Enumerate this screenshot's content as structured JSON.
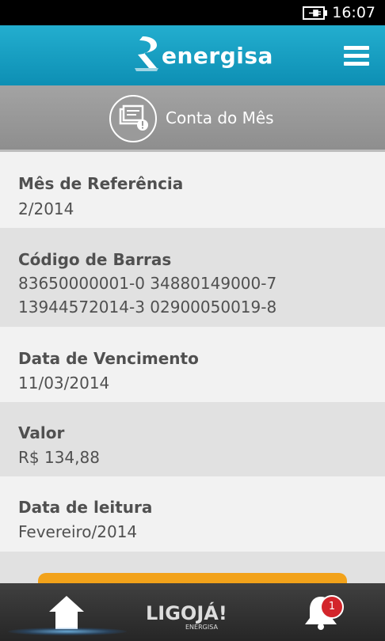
{
  "status_bar": {
    "time": "16:07",
    "battery_icon": "battery-charging-icon"
  },
  "header": {
    "brand": "energisa",
    "logo_icon": "energisa-logo-icon",
    "menu_icon": "hamburger-menu-icon"
  },
  "section": {
    "title": "Conta do Mês",
    "icon": "bill-document-icon"
  },
  "fields": [
    {
      "label": "Mês de Referência",
      "value": "2/2014"
    },
    {
      "label": "Código de Barras",
      "value_line1": "83650000001-0 34880149000-7",
      "value_line2": "13944572014-3 02900050019-8"
    },
    {
      "label": "Data de Vencimento",
      "value": "11/03/2014"
    },
    {
      "label": "Valor",
      "value": "R$ 134,88"
    },
    {
      "label": "Data de leitura",
      "value": "Fevereiro/2014"
    }
  ],
  "bottom_nav": {
    "home_icon": "home-icon",
    "ligoja_logo": "LIGOJÁ!",
    "ligoja_sub": "ENERGISA",
    "bell_icon": "bell-icon",
    "notification_count": "1"
  },
  "colors": {
    "header": "#1a9fc3",
    "section": "#999999",
    "accent_button": "#f2a21a",
    "badge": "#d3252b"
  }
}
